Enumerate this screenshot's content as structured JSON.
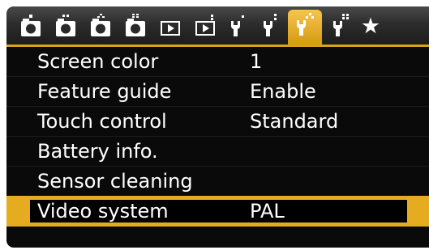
{
  "tabs": [
    {
      "icon": "camera-shooting-icon",
      "dots": 1,
      "active": false
    },
    {
      "icon": "camera-shooting-icon",
      "dots": 2,
      "active": false
    },
    {
      "icon": "camera-shooting-icon",
      "dots": 3,
      "active": false
    },
    {
      "icon": "camera-shooting-icon",
      "dots": 4,
      "active": false
    },
    {
      "icon": "playback-icon",
      "dots": 1,
      "active": false
    },
    {
      "icon": "playback-icon",
      "dots": 2,
      "active": false
    },
    {
      "icon": "wrench-setup-icon",
      "dots": 1,
      "active": false
    },
    {
      "icon": "wrench-setup-icon",
      "dots": 2,
      "active": false
    },
    {
      "icon": "wrench-setup-icon",
      "dots": 3,
      "active": true
    },
    {
      "icon": "wrench-setup-icon",
      "dots": 4,
      "active": false
    },
    {
      "icon": "star-my-menu-icon",
      "glyph": "★",
      "active": false
    }
  ],
  "menu": {
    "items": [
      {
        "label": "Screen color",
        "value": "1"
      },
      {
        "label": "Feature guide",
        "value": "Enable"
      },
      {
        "label": "Touch control",
        "value": "Standard"
      },
      {
        "label": "Battery info.",
        "value": ""
      },
      {
        "label": "Sensor cleaning",
        "value": ""
      },
      {
        "label": "Video system",
        "value": "PAL",
        "selected": true
      }
    ]
  },
  "colors": {
    "accent": "#e4ac1e",
    "background": "#0a0a0a",
    "text": "#ffffff"
  }
}
